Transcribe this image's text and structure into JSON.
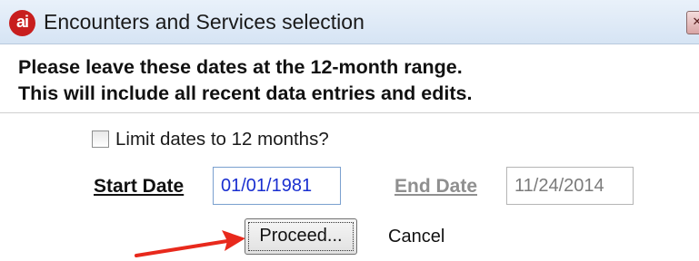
{
  "window": {
    "logo_text": "ai",
    "title": "Encounters and Services selection",
    "close_glyph": "✕"
  },
  "instructions": {
    "line1": "Please leave these dates at the 12-month range.",
    "line2": "This will include all recent data entries and edits."
  },
  "limit_checkbox": {
    "label": "Limit dates to 12 months?",
    "checked": false
  },
  "start_date": {
    "label": "Start Date",
    "value": "01/01/1981"
  },
  "end_date": {
    "label": "End Date",
    "value": "11/24/2014",
    "disabled": true
  },
  "buttons": {
    "proceed": "Proceed...",
    "cancel": "Cancel"
  },
  "annotation": {
    "arrow_icon": "red-arrow-icon",
    "arrow_color": "#e8291c"
  },
  "colors": {
    "title_bar": "#dce8f5",
    "start_value_text": "#1a2fd0",
    "disabled_text": "#8f8f8f"
  }
}
